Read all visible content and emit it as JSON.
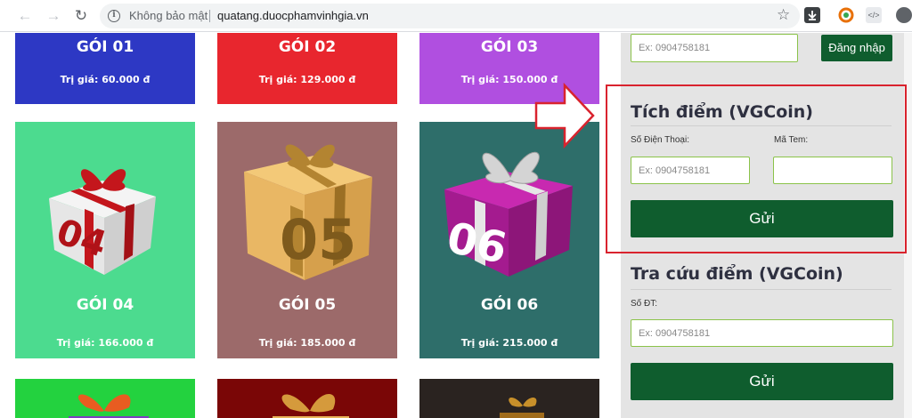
{
  "browser": {
    "back_icon": "arrow-left-icon",
    "forward_icon": "arrow-right-icon",
    "reload_icon": "reload-icon",
    "security_label": "Không bảo mật",
    "url": "quatang.duocphamvinhgia.vn",
    "bookmark_icon": "star-icon"
  },
  "packages": [
    {
      "title": "GÓI 01",
      "price": "Trị giá: 60.000 đ",
      "color": "#2d38c4"
    },
    {
      "title": "GÓI 02",
      "price": "Trị giá: 129.000 đ",
      "color": "#e8262e"
    },
    {
      "title": "GÓI 03",
      "price": "Trị giá: 150.000 đ",
      "color": "#b04fe0"
    },
    {
      "title": "GÓI 04",
      "price": "Trị giá: 166.000 đ",
      "color": "#4cdb8f",
      "number": "04"
    },
    {
      "title": "GÓI 05",
      "price": "Trị giá: 185.000 đ",
      "color": "#9c6a6a",
      "number": "05"
    },
    {
      "title": "GÓI 06",
      "price": "Trị giá: 215.000 đ",
      "color": "#2e6e6a",
      "number": "06"
    },
    {
      "color": "#23d23f"
    },
    {
      "color": "#7a0606"
    },
    {
      "color": "#2a2320"
    }
  ],
  "login": {
    "phone_placeholder": "Ex: 0904758181",
    "button": "Đăng nhập"
  },
  "earn_points": {
    "title": "Tích điểm (VGCoin)",
    "phone_label": "Số Điện Thoại:",
    "code_label": "Mã Tem:",
    "phone_placeholder": "Ex: 0904758181",
    "code_value": "",
    "submit": "Gửi"
  },
  "lookup_points": {
    "title": "Tra cứu điểm (VGCoin)",
    "phone_label": "Số ĐT:",
    "phone_placeholder": "Ex: 0904758181",
    "submit": "Gửi"
  },
  "colors": {
    "accent_green": "#0f5d2e",
    "highlight_red": "#d9232e"
  }
}
